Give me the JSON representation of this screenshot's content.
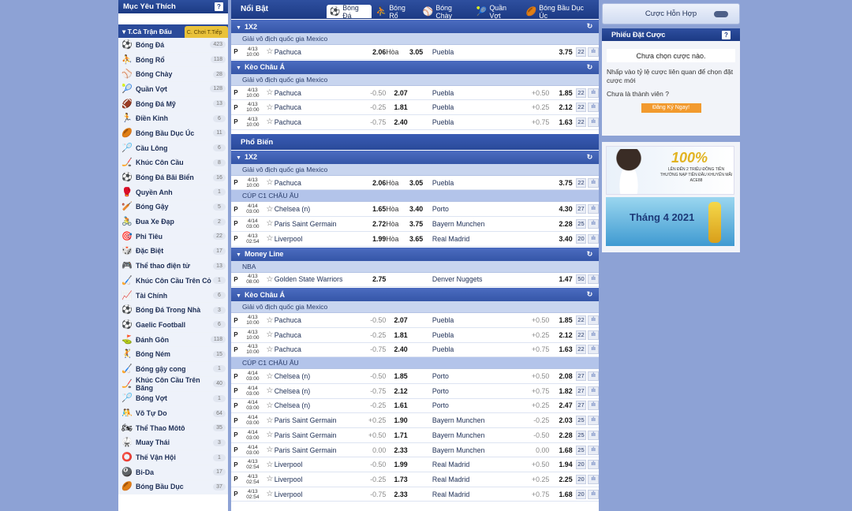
{
  "sidebar": {
    "favorites_title": "Mục Yêu Thích",
    "tab_matches": "T.Cả Trận Đấu",
    "tab_sort": "C. Chơi T.Tiếp",
    "sports": [
      {
        "name": "Bóng Đá",
        "count": "423",
        "icon": "⚽"
      },
      {
        "name": "Bóng Rổ",
        "count": "118",
        "icon": "⛹"
      },
      {
        "name": "Bóng Chày",
        "count": "28",
        "icon": "⚾"
      },
      {
        "name": "Quần Vợt",
        "count": "128",
        "icon": "🎾"
      },
      {
        "name": "Bóng Đá Mỹ",
        "count": "13",
        "icon": "🏈"
      },
      {
        "name": "Điền Kinh",
        "count": "6",
        "icon": "🏃"
      },
      {
        "name": "Bóng Bầu Dục Úc",
        "count": "11",
        "icon": "🏉"
      },
      {
        "name": "Cầu Lông",
        "count": "6",
        "icon": "🏸"
      },
      {
        "name": "Khúc Côn Cầu",
        "count": "8",
        "icon": "🏒"
      },
      {
        "name": "Bóng Đá Bãi Biển",
        "count": "16",
        "icon": "⚽"
      },
      {
        "name": "Quyền Anh",
        "count": "1",
        "icon": "🥊"
      },
      {
        "name": "Bóng Gậy",
        "count": "5",
        "icon": "🏏"
      },
      {
        "name": "Đua Xe Đạp",
        "count": "2",
        "icon": "🚴"
      },
      {
        "name": "Phi Tiêu",
        "count": "22",
        "icon": "🎯"
      },
      {
        "name": "Đặc Biệt",
        "count": "17",
        "icon": "🎲"
      },
      {
        "name": "Thể thao điện tử",
        "count": "13",
        "icon": "🎮"
      },
      {
        "name": "Khúc Côn Cầu Trên Cỏ",
        "count": "1",
        "icon": "🏑"
      },
      {
        "name": "Tài Chính",
        "count": "6",
        "icon": "📈"
      },
      {
        "name": "Bóng Đá Trong Nhà",
        "count": "3",
        "icon": "⚽"
      },
      {
        "name": "Gaelic Football",
        "count": "6",
        "icon": "⚽"
      },
      {
        "name": "Đánh Gôn",
        "count": "118",
        "icon": "⛳"
      },
      {
        "name": "Bóng Ném",
        "count": "15",
        "icon": "🤾"
      },
      {
        "name": "Bóng gậy cong",
        "count": "1",
        "icon": "🏑"
      },
      {
        "name": "Khúc Côn Cầu Trên Băng",
        "count": "40",
        "icon": "🏒"
      },
      {
        "name": "Bóng Vợt",
        "count": "1",
        "icon": "🏸"
      },
      {
        "name": "Võ Tự Do",
        "count": "64",
        "icon": "🤼"
      },
      {
        "name": "Thể Thao Môtô",
        "count": "35",
        "icon": "🏍"
      },
      {
        "name": "Muay Thái",
        "count": "3",
        "icon": "🥋"
      },
      {
        "name": "Thế Vận Hội",
        "count": "1",
        "icon": "⭕"
      },
      {
        "name": "Bi-Da",
        "count": "17",
        "icon": "🎱"
      },
      {
        "name": "Bóng Bầu Dục",
        "count": "37",
        "icon": "🏉"
      }
    ]
  },
  "main": {
    "highlight_title": "Nổi Bật",
    "sport_tabs": [
      {
        "label": "Bóng Đá",
        "icon": "⚽"
      },
      {
        "label": "Bóng Rổ",
        "icon": "⛹"
      },
      {
        "label": "Bóng Chày",
        "icon": "⚾"
      },
      {
        "label": "Quần Vợt",
        "icon": "🎾"
      },
      {
        "label": "Bóng Bầu Dục Úc",
        "icon": "🏉"
      }
    ],
    "popular_title": "Phổ Biến",
    "p": "P",
    "draw_label": "Hòa",
    "stat_icon": "ılı",
    "blocks": [
      {
        "type": "section",
        "title": "1X2"
      },
      {
        "type": "league",
        "name": "Giải vô địch quốc gia Mexico"
      },
      {
        "type": "x12",
        "date": "4/13",
        "time": "10:00",
        "home": "Pachuca",
        "h_odd": "2.06",
        "d_odd": "3.05",
        "away": "Puebla",
        "a_odd": "3.75",
        "cnt": "22"
      },
      {
        "type": "section",
        "title": "Kèo Châu Á"
      },
      {
        "type": "league",
        "name": "Giải vô địch quốc gia Mexico"
      },
      {
        "type": "ah",
        "date": "4/13",
        "time": "10:00",
        "home": "Pachuca",
        "h_hcp": "-0.50",
        "h_odd": "2.07",
        "away": "Puebla",
        "a_hcp": "+0.50",
        "a_odd": "1.85",
        "cnt": "22"
      },
      {
        "type": "ah",
        "date": "4/13",
        "time": "10:00",
        "home": "Pachuca",
        "h_hcp": "-0.25",
        "h_odd": "1.81",
        "away": "Puebla",
        "a_hcp": "+0.25",
        "a_odd": "2.12",
        "cnt": "22"
      },
      {
        "type": "ah",
        "date": "4/13",
        "time": "10:00",
        "home": "Pachuca",
        "h_hcp": "-0.75",
        "h_odd": "2.40",
        "away": "Puebla",
        "a_hcp": "+0.75",
        "a_odd": "1.63",
        "cnt": "22"
      },
      {
        "type": "group",
        "title": "Phổ Biến"
      },
      {
        "type": "section",
        "title": "1X2"
      },
      {
        "type": "league",
        "name": "Giải vô địch quốc gia Mexico"
      },
      {
        "type": "x12",
        "date": "4/13",
        "time": "10:00",
        "home": "Pachuca",
        "h_odd": "2.06",
        "d_odd": "3.05",
        "away": "Puebla",
        "a_odd": "3.75",
        "cnt": "22"
      },
      {
        "type": "league",
        "name": "CÚP C1 CHÂU ÂU",
        "blue": true
      },
      {
        "type": "x12",
        "date": "4/14",
        "time": "03:00",
        "home": "Chelsea (n)",
        "h_odd": "1.65",
        "d_odd": "3.40",
        "away": "Porto",
        "a_odd": "4.30",
        "cnt": "27"
      },
      {
        "type": "x12",
        "date": "4/14",
        "time": "03:00",
        "home": "Paris Saint Germain",
        "h_odd": "2.72",
        "d_odd": "3.75",
        "away": "Bayern Munchen",
        "a_odd": "2.28",
        "cnt": "25"
      },
      {
        "type": "x12",
        "date": "4/13",
        "time": "02:54",
        "home": "Liverpool",
        "h_odd": "1.99",
        "d_odd": "3.65",
        "away": "Real Madrid",
        "a_odd": "3.40",
        "cnt": "20"
      },
      {
        "type": "section",
        "title": "Money Line"
      },
      {
        "type": "league",
        "name": "NBA"
      },
      {
        "type": "ml",
        "date": "4/13",
        "time": "08:00",
        "home": "Golden State Warriors",
        "h_odd": "2.75",
        "away": "Denver Nuggets",
        "a_odd": "1.47",
        "cnt": "50"
      },
      {
        "type": "section",
        "title": "Kèo Châu Á"
      },
      {
        "type": "league",
        "name": "Giải vô địch quốc gia Mexico"
      },
      {
        "type": "ah",
        "date": "4/13",
        "time": "10:00",
        "home": "Pachuca",
        "h_hcp": "-0.50",
        "h_odd": "2.07",
        "away": "Puebla",
        "a_hcp": "+0.50",
        "a_odd": "1.85",
        "cnt": "22"
      },
      {
        "type": "ah",
        "date": "4/13",
        "time": "10:00",
        "home": "Pachuca",
        "h_hcp": "-0.25",
        "h_odd": "1.81",
        "away": "Puebla",
        "a_hcp": "+0.25",
        "a_odd": "2.12",
        "cnt": "22"
      },
      {
        "type": "ah",
        "date": "4/13",
        "time": "10:00",
        "home": "Pachuca",
        "h_hcp": "-0.75",
        "h_odd": "2.40",
        "away": "Puebla",
        "a_hcp": "+0.75",
        "a_odd": "1.63",
        "cnt": "22"
      },
      {
        "type": "league",
        "name": "CÚP C1 CHÂU ÂU",
        "blue": true
      },
      {
        "type": "ah",
        "date": "4/14",
        "time": "03:00",
        "home": "Chelsea (n)",
        "h_hcp": "-0.50",
        "h_odd": "1.85",
        "away": "Porto",
        "a_hcp": "+0.50",
        "a_odd": "2.08",
        "cnt": "27"
      },
      {
        "type": "ah",
        "date": "4/14",
        "time": "03:00",
        "home": "Chelsea (n)",
        "h_hcp": "-0.75",
        "h_odd": "2.12",
        "away": "Porto",
        "a_hcp": "+0.75",
        "a_odd": "1.82",
        "cnt": "27"
      },
      {
        "type": "ah",
        "date": "4/14",
        "time": "03:00",
        "home": "Chelsea (n)",
        "h_hcp": "-0.25",
        "h_odd": "1.61",
        "away": "Porto",
        "a_hcp": "+0.25",
        "a_odd": "2.47",
        "cnt": "27"
      },
      {
        "type": "ah",
        "date": "4/14",
        "time": "03:00",
        "home": "Paris Saint Germain",
        "h_hcp": "+0.25",
        "h_odd": "1.90",
        "away": "Bayern Munchen",
        "a_hcp": "-0.25",
        "a_odd": "2.03",
        "cnt": "25"
      },
      {
        "type": "ah",
        "date": "4/14",
        "time": "03:00",
        "home": "Paris Saint Germain",
        "h_hcp": "+0.50",
        "h_odd": "1.71",
        "away": "Bayern Munchen",
        "a_hcp": "-0.50",
        "a_odd": "2.28",
        "cnt": "25"
      },
      {
        "type": "ah",
        "date": "4/14",
        "time": "03:00",
        "home": "Paris Saint Germain",
        "h_hcp": "0.00",
        "h_odd": "2.33",
        "away": "Bayern Munchen",
        "a_hcp": "0.00",
        "a_odd": "1.68",
        "cnt": "25"
      },
      {
        "type": "ah",
        "date": "4/13",
        "time": "02:54",
        "home": "Liverpool",
        "h_hcp": "-0.50",
        "h_odd": "1.99",
        "away": "Real Madrid",
        "a_hcp": "+0.50",
        "a_odd": "1.94",
        "cnt": "20"
      },
      {
        "type": "ah",
        "date": "4/13",
        "time": "02:54",
        "home": "Liverpool",
        "h_hcp": "-0.25",
        "h_odd": "1.73",
        "away": "Real Madrid",
        "a_hcp": "+0.25",
        "a_odd": "2.25",
        "cnt": "20"
      },
      {
        "type": "ah",
        "date": "4/13",
        "time": "02:54",
        "home": "Liverpool",
        "h_hcp": "-0.75",
        "h_odd": "2.33",
        "away": "Real Madrid",
        "a_hcp": "+0.75",
        "a_odd": "1.68",
        "cnt": "20"
      }
    ]
  },
  "right": {
    "mix_label": "Cược Hỗn Hợp",
    "slip_title": "Phiếu Đặt Cược",
    "slip_empty": "Chưa chọn cược nào.",
    "slip_hint": "Nhấp vào tỷ lệ cược liên quan để chọn đặt cược mới",
    "not_member": "Chưa là thành viên ?",
    "register": "Đăng Ký Ngay!",
    "ad1_big": "100%",
    "ad1_text": "LÊN ĐẾN 2 TRIỆU ĐỒNG TIỀN THƯỞNG NẠP TIỀN ĐẦU KHUYẾN MÃI ACE88",
    "ad2_text": "Tháng 4 2021"
  }
}
